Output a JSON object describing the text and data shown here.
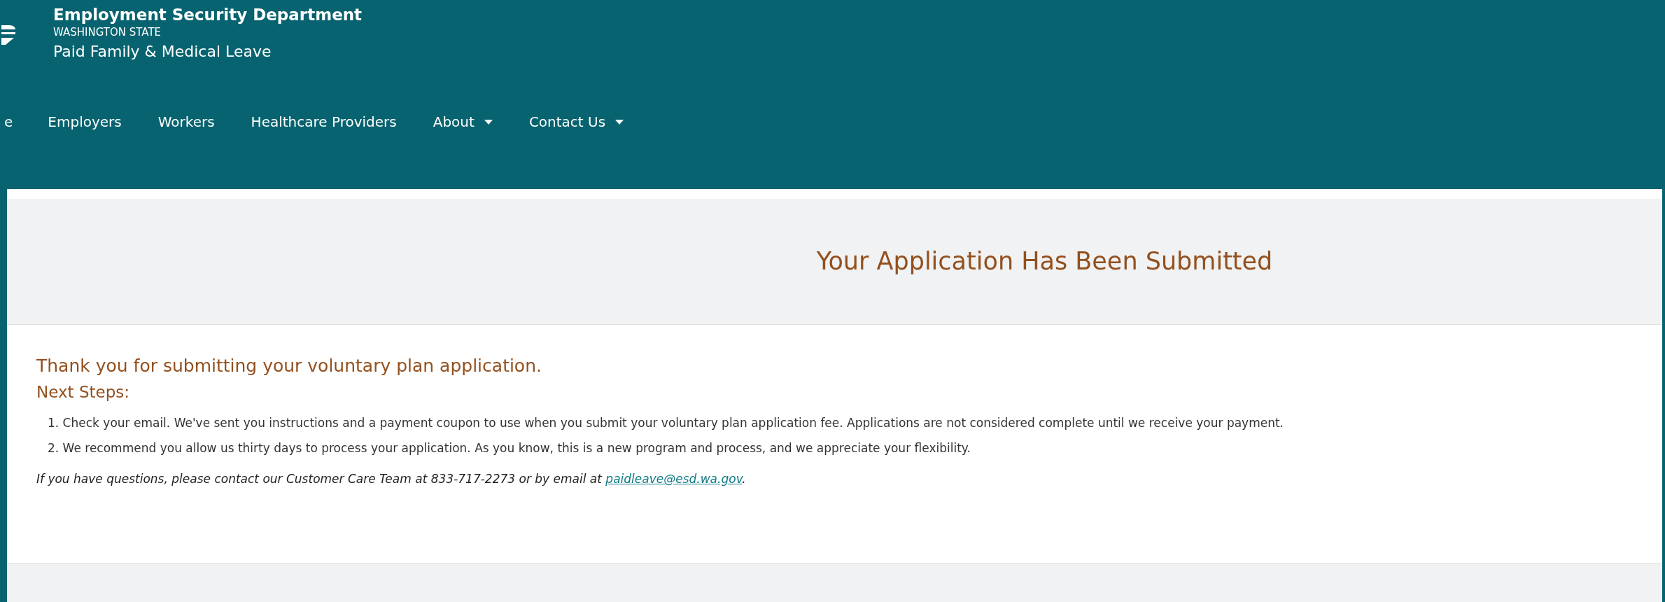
{
  "header": {
    "agency": "Employment Security Department",
    "state": "WASHINGTON STATE",
    "program": "Paid Family & Medical Leave"
  },
  "nav": [
    {
      "label": "e",
      "dropdown": false
    },
    {
      "label": "Employers",
      "dropdown": false
    },
    {
      "label": "Workers",
      "dropdown": false
    },
    {
      "label": "Healthcare Providers",
      "dropdown": false
    },
    {
      "label": "About",
      "dropdown": true
    },
    {
      "label": "Contact Us",
      "dropdown": true
    }
  ],
  "title": "Your Application Has Been Submitted",
  "thanks": "Thank you for submitting your voluntary plan application.",
  "next_steps": {
    "heading": "Next Steps:",
    "items": [
      "1. Check your email. We've sent you instructions and a payment coupon to use when you submit your voluntary plan application fee. Applications are not considered complete until we receive your payment.",
      "2. We recommend you allow us thirty days to process your application. As you know, this is a new program and process, and we appreciate your flexibility."
    ]
  },
  "contact": {
    "text": "If you have questions, please contact our Customer Care Team at 833-717-2273 or by email at",
    "link": "paidleave@esd.wa.gov",
    "end": "."
  }
}
